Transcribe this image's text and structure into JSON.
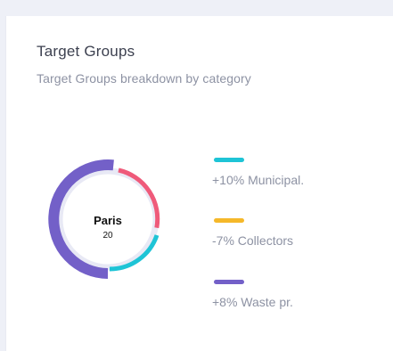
{
  "card": {
    "title": "Target Groups",
    "subtitle": "Target Groups breakdown by category"
  },
  "donut": {
    "center_label": "Paris",
    "center_value": "20",
    "track_color": "#e8e9f5"
  },
  "legend": [
    {
      "text": "+10% Municipal.",
      "color": "#1ec4d6",
      "icon": "cyan-bar-swatch"
    },
    {
      "text": "-7% Collectors",
      "color": "#f5b82a",
      "icon": "yellow-bar-swatch"
    },
    {
      "text": "+8% Waste pr.",
      "color": "#7360c8",
      "icon": "purple-bar-swatch"
    }
  ]
}
